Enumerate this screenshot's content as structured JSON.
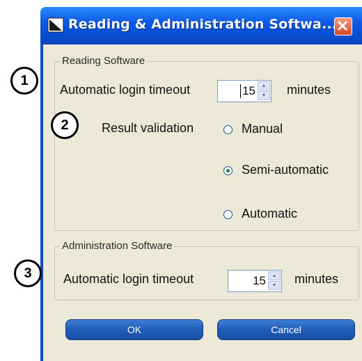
{
  "window": {
    "title": "Reading & Administration Softwa...",
    "close_label": "✕"
  },
  "reading_group": {
    "label": "Reading Software",
    "timeout_label": "Automatic login timeout",
    "timeout_value": "15",
    "timeout_unit": "minutes",
    "validation_label": "Result validation",
    "options": [
      {
        "label": "Manual",
        "checked": false
      },
      {
        "label": "Semi-automatic",
        "checked": true
      },
      {
        "label": "Automatic",
        "checked": false
      }
    ]
  },
  "admin_group": {
    "label": "Administration Software",
    "timeout_label": "Automatic login timeout",
    "timeout_value": "15",
    "timeout_unit": "minutes"
  },
  "buttons": {
    "ok_label": "OK",
    "cancel_label": "Cancel"
  },
  "callouts": [
    "1",
    "2",
    "3"
  ],
  "colors": {
    "titlebar": "#0650d6",
    "dialog_bg": "#ece9d8",
    "close": "#d64a22",
    "button": "#1e5cb8"
  }
}
